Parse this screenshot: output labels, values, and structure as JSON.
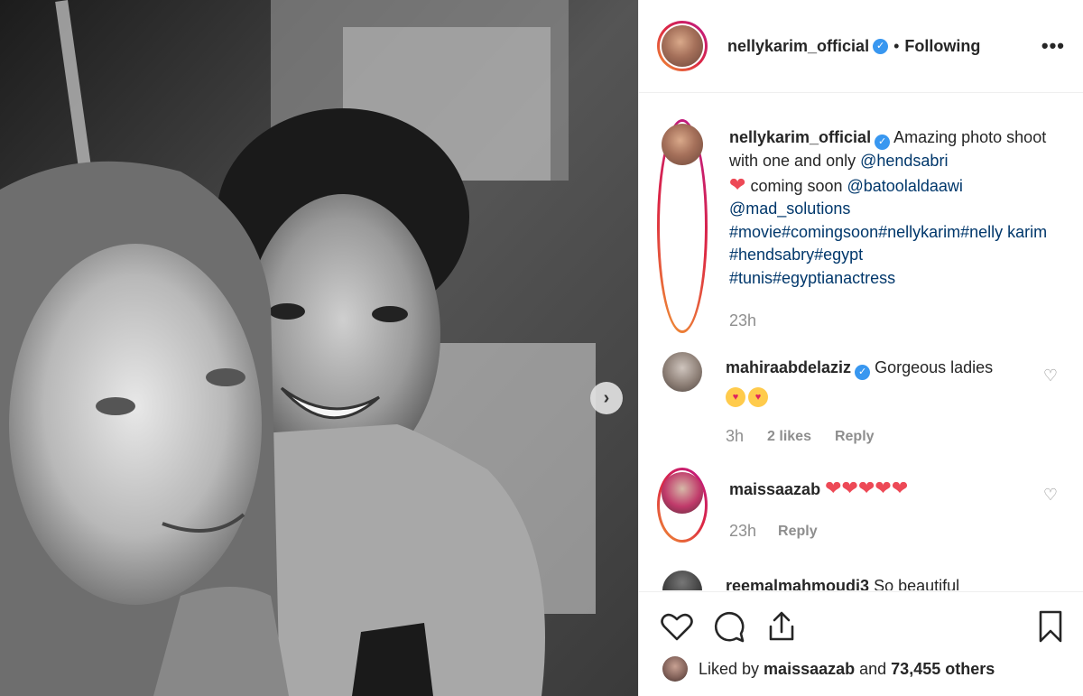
{
  "post": {
    "image_alt": "Black and white selfie of two women",
    "next_arrow": "›"
  },
  "header": {
    "username": "nellykarim_official",
    "separator": "•",
    "follow_status": "Following",
    "more_icon": "•••"
  },
  "caption": {
    "username": "nellykarim_official",
    "text_1": "Amazing photo shoot with one and only ",
    "mention_1": "@hendsabri",
    "text_2": " coming soon ",
    "mention_2": "@batoolaldaawi",
    "mention_3": "@mad_solutions",
    "hashtags_1": "#movie#comingsoon#nellykarim#nelly karim",
    "hashtags_2": " #hendsabry#egypt",
    "hashtags_3": "#tunis#egyptianactress",
    "time": "23h"
  },
  "comments": [
    {
      "username": "mahiraabdelaziz",
      "text": "Gorgeous ladies",
      "time": "3h",
      "likes": "2 likes",
      "reply": "Reply"
    },
    {
      "username": "maissaazab",
      "text": "",
      "time": "23h",
      "reply": "Reply"
    },
    {
      "username": "reemalmahmoudi3",
      "text": "So beautiful"
    }
  ],
  "likes": {
    "prefix": "Liked by ",
    "user": "maissaazab",
    "middle": " and ",
    "count": "73,455 others"
  },
  "icons": {
    "verified": "✓",
    "heart": "❤",
    "small_heart": "♡"
  },
  "colors": {
    "link": "#00376b",
    "verified": "#3897f0",
    "heart_red": "#ed4956"
  }
}
